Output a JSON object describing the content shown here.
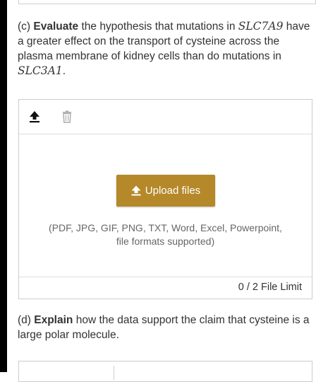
{
  "question_c": {
    "prefix": "(c) ",
    "verb": "Evaluate",
    "text1": " the hypothesis that mutations in ",
    "gene1": "SLC7A9",
    "text2": " have a greater effect on the transport of cysteine across the plasma membrane of kidney cells than do mutations in ",
    "gene2": "SLC3A1",
    "text3": "."
  },
  "upload": {
    "upload_icon": "upload-arrow-icon",
    "delete_icon": "trash-icon",
    "button_label": "Upload files",
    "formats_line1": "(PDF, JPG, GIF, PNG, TXT, Word, Excel, Powerpoint,",
    "formats_line2": "file formats supported)",
    "file_limit": "0 / 2 File Limit"
  },
  "question_d": {
    "prefix": "(d) ",
    "verb": "Explain",
    "text": " how the data support the claim that cysteine is a large polar molecule."
  },
  "colors": {
    "button": "#b5882a",
    "button_text": "#ffffff",
    "text": "#333333",
    "muted": "#666666"
  }
}
